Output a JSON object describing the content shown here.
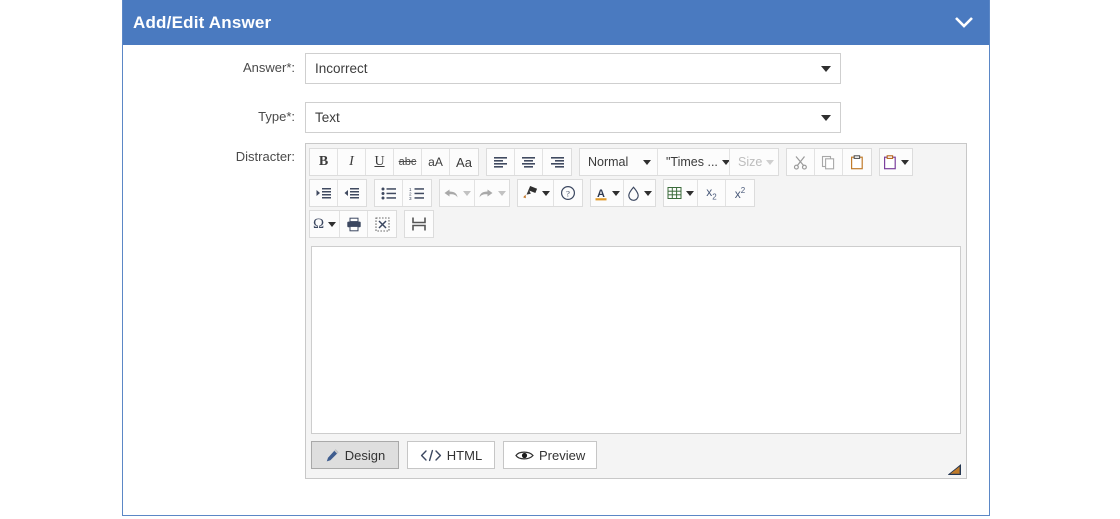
{
  "panel": {
    "title": "Add/Edit Answer",
    "collapse_icon": "chevron-down-icon",
    "header_color": "#4a7ac0",
    "border_color": "#5b87c6"
  },
  "form": {
    "answer": {
      "label": "Answer*:",
      "value": "Incorrect",
      "caret_icon": "chevron-down-icon"
    },
    "type": {
      "label": "Type*:",
      "value": "Text",
      "caret_icon": "chevron-down-icon"
    },
    "distracter": {
      "label": "Distracter:"
    }
  },
  "editor": {
    "content": "",
    "toolbar_rows": [
      {
        "groups": [
          {
            "name": "text-style-group",
            "buttons": [
              {
                "name": "bold-button",
                "label": "B",
                "icon": "bold-icon",
                "style": "bold-b",
                "disabled": false
              },
              {
                "name": "italic-button",
                "label": "I",
                "icon": "italic-icon",
                "style": "ital-i",
                "disabled": false
              },
              {
                "name": "underline-button",
                "label": "U",
                "icon": "underline-icon",
                "style": "undl-u",
                "disabled": false
              },
              {
                "name": "strikethrough-button",
                "label": "abc",
                "icon": "strikethrough-icon",
                "style": "strike-s",
                "disabled": false
              },
              {
                "name": "lowercase-button",
                "label": "aA",
                "icon": "lowercase-icon",
                "style": "case-sm",
                "disabled": false
              },
              {
                "name": "uppercase-button",
                "label": "Aa",
                "icon": "uppercase-icon",
                "style": "case-lg",
                "disabled": false
              }
            ]
          },
          {
            "name": "alignment-group",
            "buttons": [
              {
                "name": "align-left-button",
                "icon": "align-left-icon",
                "disabled": false
              },
              {
                "name": "align-center-button",
                "icon": "align-center-icon",
                "disabled": false
              },
              {
                "name": "align-right-button",
                "icon": "align-right-icon",
                "disabled": false
              }
            ]
          },
          {
            "name": "font-group",
            "combos": [
              {
                "name": "paragraph-format-select",
                "value": "Normal",
                "width": "w-normal",
                "disabled": false
              },
              {
                "name": "font-family-select",
                "value": "\"Times ...",
                "width": "w-font",
                "disabled": false
              },
              {
                "name": "font-size-select",
                "value": "Size",
                "width": "w-size",
                "disabled": true
              }
            ]
          },
          {
            "name": "clipboard-group",
            "buttons": [
              {
                "name": "cut-button",
                "icon": "scissors-icon",
                "disabled": true
              },
              {
                "name": "copy-button",
                "icon": "copy-icon",
                "disabled": true
              },
              {
                "name": "paste-button",
                "icon": "clipboard-icon",
                "disabled": false
              }
            ]
          },
          {
            "name": "paste-special-group",
            "buttons": [
              {
                "name": "paste-special-button",
                "icon": "clipboard-purple-icon",
                "has_caret": true,
                "disabled": false
              }
            ]
          }
        ]
      },
      {
        "groups": [
          {
            "name": "indent-group",
            "buttons": [
              {
                "name": "indent-button",
                "icon": "indent-increase-icon",
                "disabled": false
              },
              {
                "name": "outdent-button",
                "icon": "indent-decrease-icon",
                "disabled": false
              }
            ]
          },
          {
            "name": "list-group",
            "buttons": [
              {
                "name": "bullet-list-button",
                "icon": "bullet-list-icon",
                "disabled": false
              },
              {
                "name": "numbered-list-button",
                "icon": "numbered-list-icon",
                "disabled": false
              }
            ]
          },
          {
            "name": "history-group",
            "buttons": [
              {
                "name": "undo-button",
                "icon": "undo-arrow-icon",
                "has_caret": true,
                "disabled": true
              },
              {
                "name": "redo-button",
                "icon": "redo-arrow-icon",
                "has_caret": true,
                "disabled": true
              }
            ]
          },
          {
            "name": "format-painter-group",
            "buttons": [
              {
                "name": "format-painter-button",
                "icon": "format-painter-icon",
                "has_caret": true,
                "disabled": false
              },
              {
                "name": "help-button",
                "icon": "question-circle-icon",
                "disabled": false
              }
            ]
          },
          {
            "name": "color-group",
            "buttons": [
              {
                "name": "font-color-button",
                "label": "A",
                "icon": "font-color-icon",
                "has_caret": true,
                "disabled": false
              },
              {
                "name": "background-color-button",
                "icon": "droplet-icon",
                "has_caret": true,
                "disabled": false
              }
            ]
          },
          {
            "name": "table-script-group",
            "buttons": [
              {
                "name": "insert-table-button",
                "icon": "table-grid-icon",
                "has_caret": true,
                "disabled": false
              },
              {
                "name": "subscript-button",
                "icon": "subscript-icon",
                "disabled": false
              },
              {
                "name": "superscript-button",
                "icon": "superscript-icon",
                "disabled": false
              }
            ]
          }
        ]
      },
      {
        "groups": [
          {
            "name": "insert-group",
            "buttons": [
              {
                "name": "special-character-button",
                "label": "Ω",
                "icon": "omega-icon",
                "has_caret": true,
                "disabled": false
              },
              {
                "name": "print-button",
                "icon": "printer-icon",
                "disabled": false
              },
              {
                "name": "select-all-button",
                "icon": "dotted-select-icon",
                "disabled": false
              }
            ]
          },
          {
            "name": "page-break-group",
            "buttons": [
              {
                "name": "page-break-button",
                "icon": "page-break-icon",
                "disabled": false
              }
            ]
          }
        ]
      }
    ],
    "tabs": [
      {
        "name": "tab-design",
        "label": "Design",
        "icon": "pencil-icon",
        "active": true
      },
      {
        "name": "tab-html",
        "label": "HTML",
        "icon": "code-brackets-icon",
        "active": false
      },
      {
        "name": "tab-preview",
        "label": "Preview",
        "icon": "eye-icon",
        "active": false
      }
    ],
    "resize_grip_icon": "resize-grip-icon"
  }
}
